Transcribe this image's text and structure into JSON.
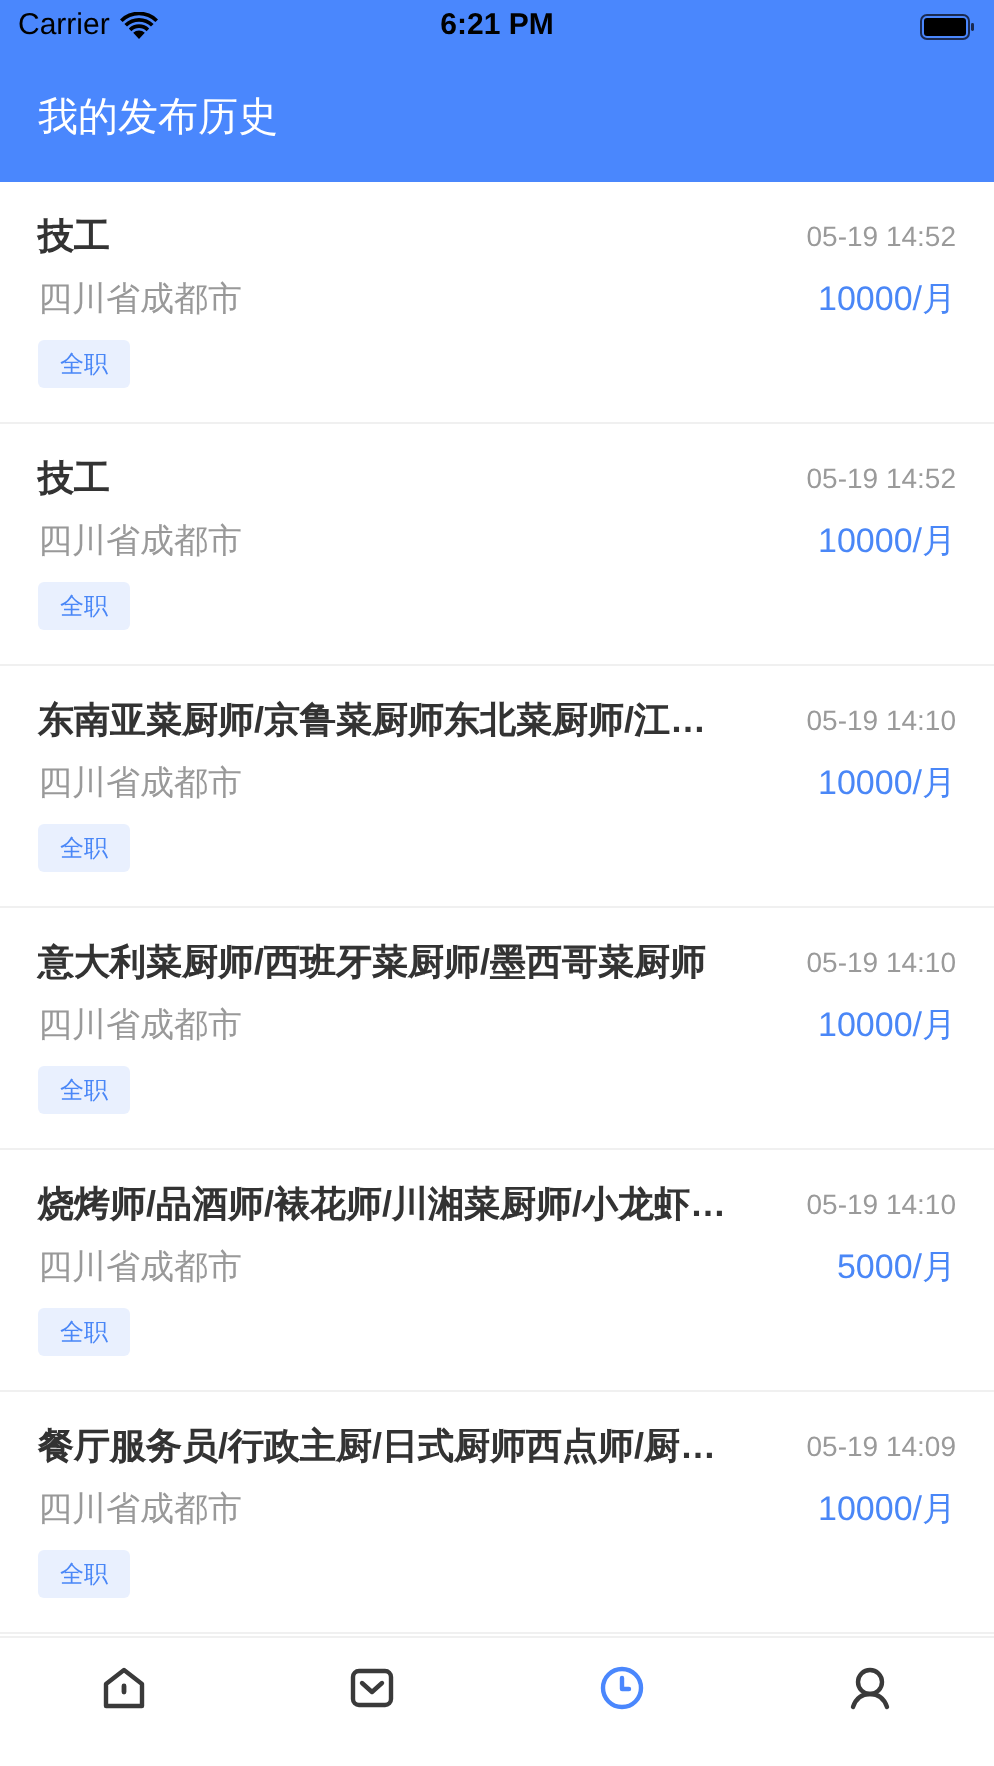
{
  "status_bar": {
    "carrier": "Carrier",
    "time": "6:21 PM"
  },
  "nav_bar": {
    "title": "我的发布历史"
  },
  "posts": [
    {
      "title": "技工",
      "time": "05-19 14:52",
      "location": "四川省成都市",
      "salary": "10000/月",
      "tag": "全职"
    },
    {
      "title": "技工",
      "time": "05-19 14:52",
      "location": "四川省成都市",
      "salary": "10000/月",
      "tag": "全职"
    },
    {
      "title": "东南亚菜厨师/京鲁菜厨师东北菜厨师/江…",
      "time": "05-19 14:10",
      "location": "四川省成都市",
      "salary": "10000/月",
      "tag": "全职"
    },
    {
      "title": "意大利菜厨师/西班牙菜厨师/墨西哥菜厨师",
      "time": "05-19 14:10",
      "location": "四川省成都市",
      "salary": "10000/月",
      "tag": "全职"
    },
    {
      "title": "烧烤师/品酒师/裱花师/川湘菜厨师/小龙虾…",
      "time": "05-19 14:10",
      "location": "四川省成都市",
      "salary": "5000/月",
      "tag": "全职"
    },
    {
      "title": "餐厅服务员/行政主厨/日式厨师西点师/厨…",
      "time": "05-19 14:09",
      "location": "四川省成都市",
      "salary": "10000/月",
      "tag": "全职"
    }
  ],
  "tab_bar": [
    {
      "kind": "home",
      "selected": false
    },
    {
      "kind": "inbox",
      "selected": false
    },
    {
      "kind": "history",
      "selected": true
    },
    {
      "kind": "profile",
      "selected": false
    }
  ]
}
